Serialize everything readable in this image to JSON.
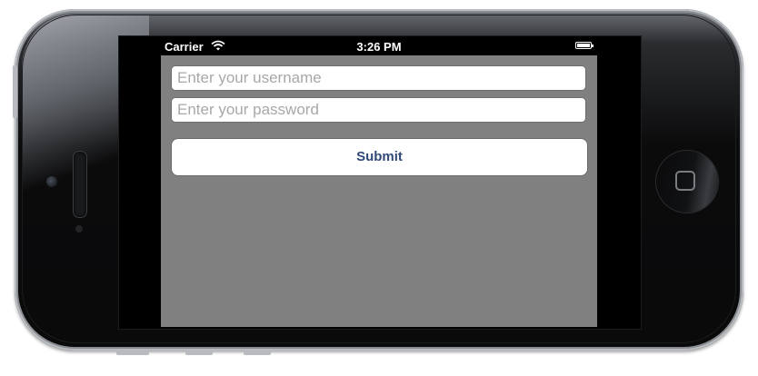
{
  "status_bar": {
    "carrier": "Carrier",
    "time": "3:26 PM",
    "icons": [
      "wifi-icon",
      "battery-icon"
    ]
  },
  "form": {
    "username_placeholder": "Enter your username",
    "password_placeholder": "Enter your password",
    "submit_label": "Submit"
  },
  "colors": {
    "background": "#808080",
    "button_text": "#32497A",
    "placeholder": "#A8A8A8"
  }
}
